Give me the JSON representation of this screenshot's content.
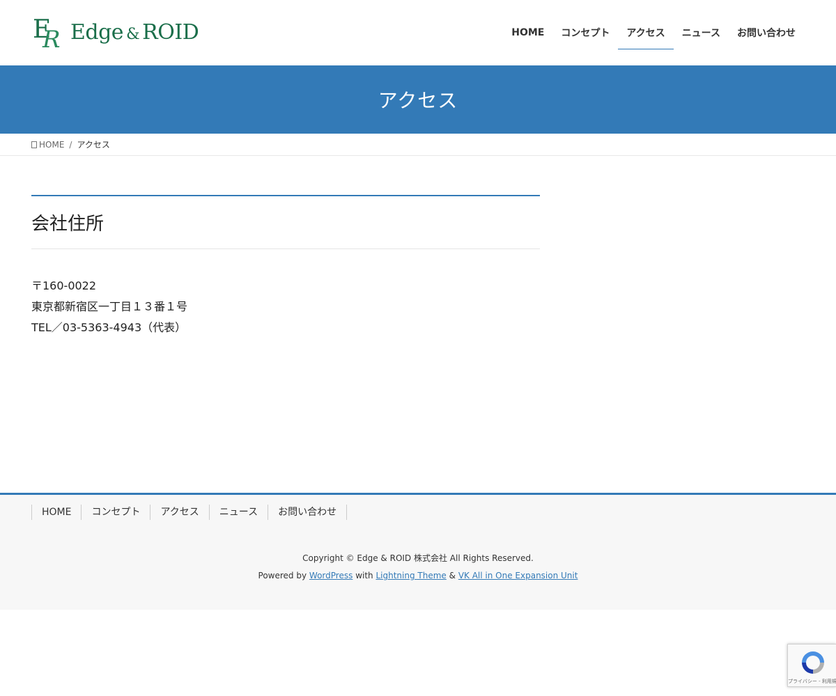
{
  "header": {
    "logo_text_left": "Edge",
    "logo_amp": "&",
    "logo_text_right": "ROID",
    "nav": [
      {
        "label": "HOME"
      },
      {
        "label": "コンセプト"
      },
      {
        "label": "アクセス",
        "current": true
      },
      {
        "label": "ニュース"
      },
      {
        "label": "お問い合わせ"
      }
    ]
  },
  "page_header": {
    "title": "アクセス"
  },
  "breadcrumb": {
    "home_icon": "home-icon",
    "home": "HOME",
    "separator": "/",
    "current": "アクセス"
  },
  "main": {
    "heading": "会社住所",
    "address": [
      "〒160-0022",
      "東京都新宿区一丁目１３番１号",
      "TEL／03-5363-4943（代表）"
    ]
  },
  "footer": {
    "nav": [
      "HOME",
      "コンセプト",
      "アクセス",
      "ニュース",
      "お問い合わせ"
    ],
    "copyright": "Copyright © Edge & ROID 株式会社 All Rights Reserved.",
    "powered_by": "Powered by",
    "wordpress": "WordPress",
    "with": "with",
    "lightning": "Lightning Theme",
    "amp": "&",
    "vk": "VK All in One Expansion Unit"
  },
  "recaptcha": {
    "icon": "recaptcha-icon",
    "text": "プライバシー - 利用規約"
  },
  "colors": {
    "accent": "#337ab7",
    "logo_green": "#1a6e4a",
    "footer_bg": "#f7f7f7"
  }
}
